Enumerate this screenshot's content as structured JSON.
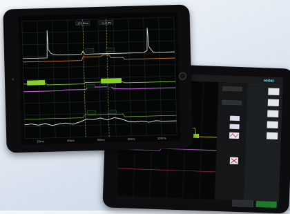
{
  "scope": {
    "cursor_readouts": [
      "153.8ms",
      "-1.21ms"
    ],
    "time_labels": [
      "20ms",
      "40ms",
      "60ms",
      "80ms",
      "100ms"
    ],
    "colors": {
      "trace_white": "#e8eef0",
      "trace_orange": "#e08a2a",
      "trace_green": "#8bd12e",
      "trace_magenta": "#c05ad6",
      "grid": "#2b3a3a",
      "cursor": "#c8d050"
    }
  },
  "panel": {
    "logo": "HIOKI",
    "right_buttons": [
      "",
      "",
      "",
      "",
      ""
    ],
    "footer_buttons": [
      "",
      ""
    ],
    "colors": {
      "accent": "#9fe040",
      "green_btn": "#3a8a2a",
      "ok_btn": "#1f7a2a"
    }
  }
}
